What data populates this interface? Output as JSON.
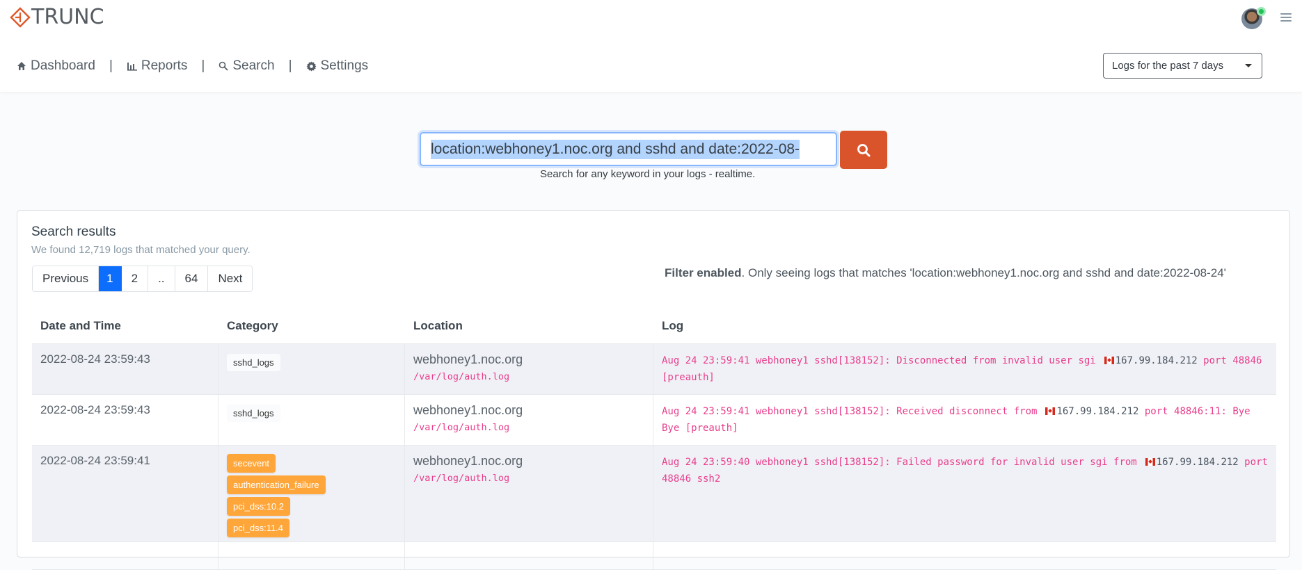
{
  "app": {
    "logo_text": "TRUNC",
    "brand_color": "#e05a2b"
  },
  "header": {
    "avatar_status": "online",
    "menu_icon": "hamburger-menu-icon"
  },
  "nav": {
    "items": [
      {
        "label": "Dashboard",
        "icon": "home-icon"
      },
      {
        "label": "Reports",
        "icon": "bar-chart-icon"
      },
      {
        "label": "Search",
        "icon": "search-icon"
      },
      {
        "label": "Settings",
        "icon": "gear-icon"
      }
    ],
    "separator": "|",
    "range_select": {
      "selected": "Logs for the past 7 days"
    }
  },
  "search": {
    "value": "location:webhoney1.noc.org and sshd and date:2022-08-",
    "hint": "Search for any keyword in your logs - realtime.",
    "button_icon": "search-icon",
    "button_color": "#d9542b"
  },
  "results": {
    "title": "Search results",
    "summary": "We found 12,719 logs that matched your query.",
    "pagination": {
      "previous": "Previous",
      "pages": [
        "1",
        "2",
        "..",
        "64"
      ],
      "active": "1",
      "next": "Next"
    },
    "filter_label": "Filter enabled",
    "filter_text": ". Only seeing logs that matches 'location:webhoney1.noc.org and sshd and date:2022-08-24'",
    "columns": [
      "Date and Time",
      "Category",
      "Location",
      "Log"
    ],
    "rows": [
      {
        "datetime": "2022-08-24 23:59:43",
        "categories": [
          "sshd_logs"
        ],
        "category_style": "plain",
        "host": "webhoney1.noc.org",
        "path": "/var/log/auth.log",
        "log_before": "Aug 24 23:59:41 webhoney1 sshd[138152]: Disconnected from invalid user sgi",
        "flag": "canada-flag",
        "ip": "167.99.184.212",
        "log_after": " port 48846 [preauth]"
      },
      {
        "datetime": "2022-08-24 23:59:43",
        "categories": [
          "sshd_logs"
        ],
        "category_style": "plain",
        "host": "webhoney1.noc.org",
        "path": "/var/log/auth.log",
        "log_before": "Aug 24 23:59:41 webhoney1 sshd[138152]: Received disconnect from",
        "flag": "canada-flag",
        "ip": "167.99.184.212",
        "log_after": " port 48846:11: Bye Bye [preauth]"
      },
      {
        "datetime": "2022-08-24 23:59:41",
        "categories": [
          "secevent",
          "authentication_failure",
          "pci_dss:10.2",
          "pci_dss:11.4"
        ],
        "category_style": "orange",
        "host": "webhoney1.noc.org",
        "path": "/var/log/auth.log",
        "log_before": "Aug 24 23:59:40 webhoney1 sshd[138152]: Failed password for invalid user sgi from",
        "flag": "canada-flag",
        "ip": "167.99.184.212",
        "log_after": " port 48846 ssh2"
      }
    ]
  }
}
